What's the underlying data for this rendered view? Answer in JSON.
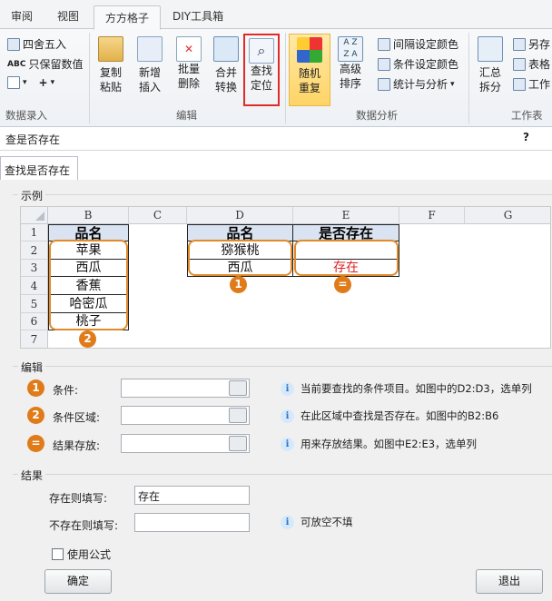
{
  "ribbon": {
    "tabs": [
      "审阅",
      "视图",
      "方方格子",
      "DIY工具箱"
    ],
    "groups": {
      "data_entry": {
        "label": "数据录入",
        "round": "四舍五入",
        "keep_values": "只保留数值"
      },
      "edit": {
        "label": "编辑",
        "copy": "复制\n粘贴",
        "insert": "新增\n插入",
        "delete": "批量\n删除",
        "merge": "合并\n转换",
        "find": "查找\n定位"
      },
      "analysis": {
        "label": "数据分析",
        "random": "随机\n重复",
        "sort": "高级\n排序",
        "alt_color": "间隔设定颜色",
        "cond_color": "条件设定颜色",
        "stats": "统计与分析"
      },
      "worksheet": {
        "label": "工作表",
        "summary": "汇总\n拆分",
        "saveas": "另存",
        "table": "表格",
        "work": "工作"
      }
    }
  },
  "dialog": {
    "title": "查是否存在",
    "help": "?",
    "tab": "查找是否存在",
    "example_title": "示例",
    "sheet": {
      "columns": [
        "B",
        "C",
        "D",
        "E",
        "F",
        "G"
      ],
      "rows": [
        "1",
        "2",
        "3",
        "4",
        "5",
        "6",
        "7"
      ],
      "b_header": "品名",
      "b_values": [
        "苹果",
        "西瓜",
        "香蕉",
        "哈密瓜",
        "桃子"
      ],
      "d_header": "品名",
      "e_header": "是否存在",
      "d_values": [
        "猕猴桃",
        "西瓜"
      ],
      "e_values": [
        "",
        "存在"
      ],
      "badges": {
        "one": "1",
        "two": "2",
        "eq": "="
      }
    },
    "edit_title": "编辑",
    "fields": [
      {
        "badge": "1",
        "label": "条件:",
        "value": "",
        "hint": "当前要查找的条件项目。如图中的D2:D3，选单列"
      },
      {
        "badge": "2",
        "label": "条件区域:",
        "value": "",
        "hint": "在此区域中查找是否存在。如图中的B2:B6"
      },
      {
        "badge": "=",
        "label": "结果存放:",
        "value": "",
        "hint": "用来存放结果。如图中E2:E3，选单列"
      }
    ],
    "result_title": "结果",
    "exist_label": "存在则填写:",
    "exist_value": "存在",
    "notexist_label": "不存在则填写:",
    "notexist_value": "",
    "notexist_hint": "可放空不填",
    "use_formula": "使用公式",
    "ok": "确定",
    "exit": "退出",
    "info_glyph": "i"
  }
}
